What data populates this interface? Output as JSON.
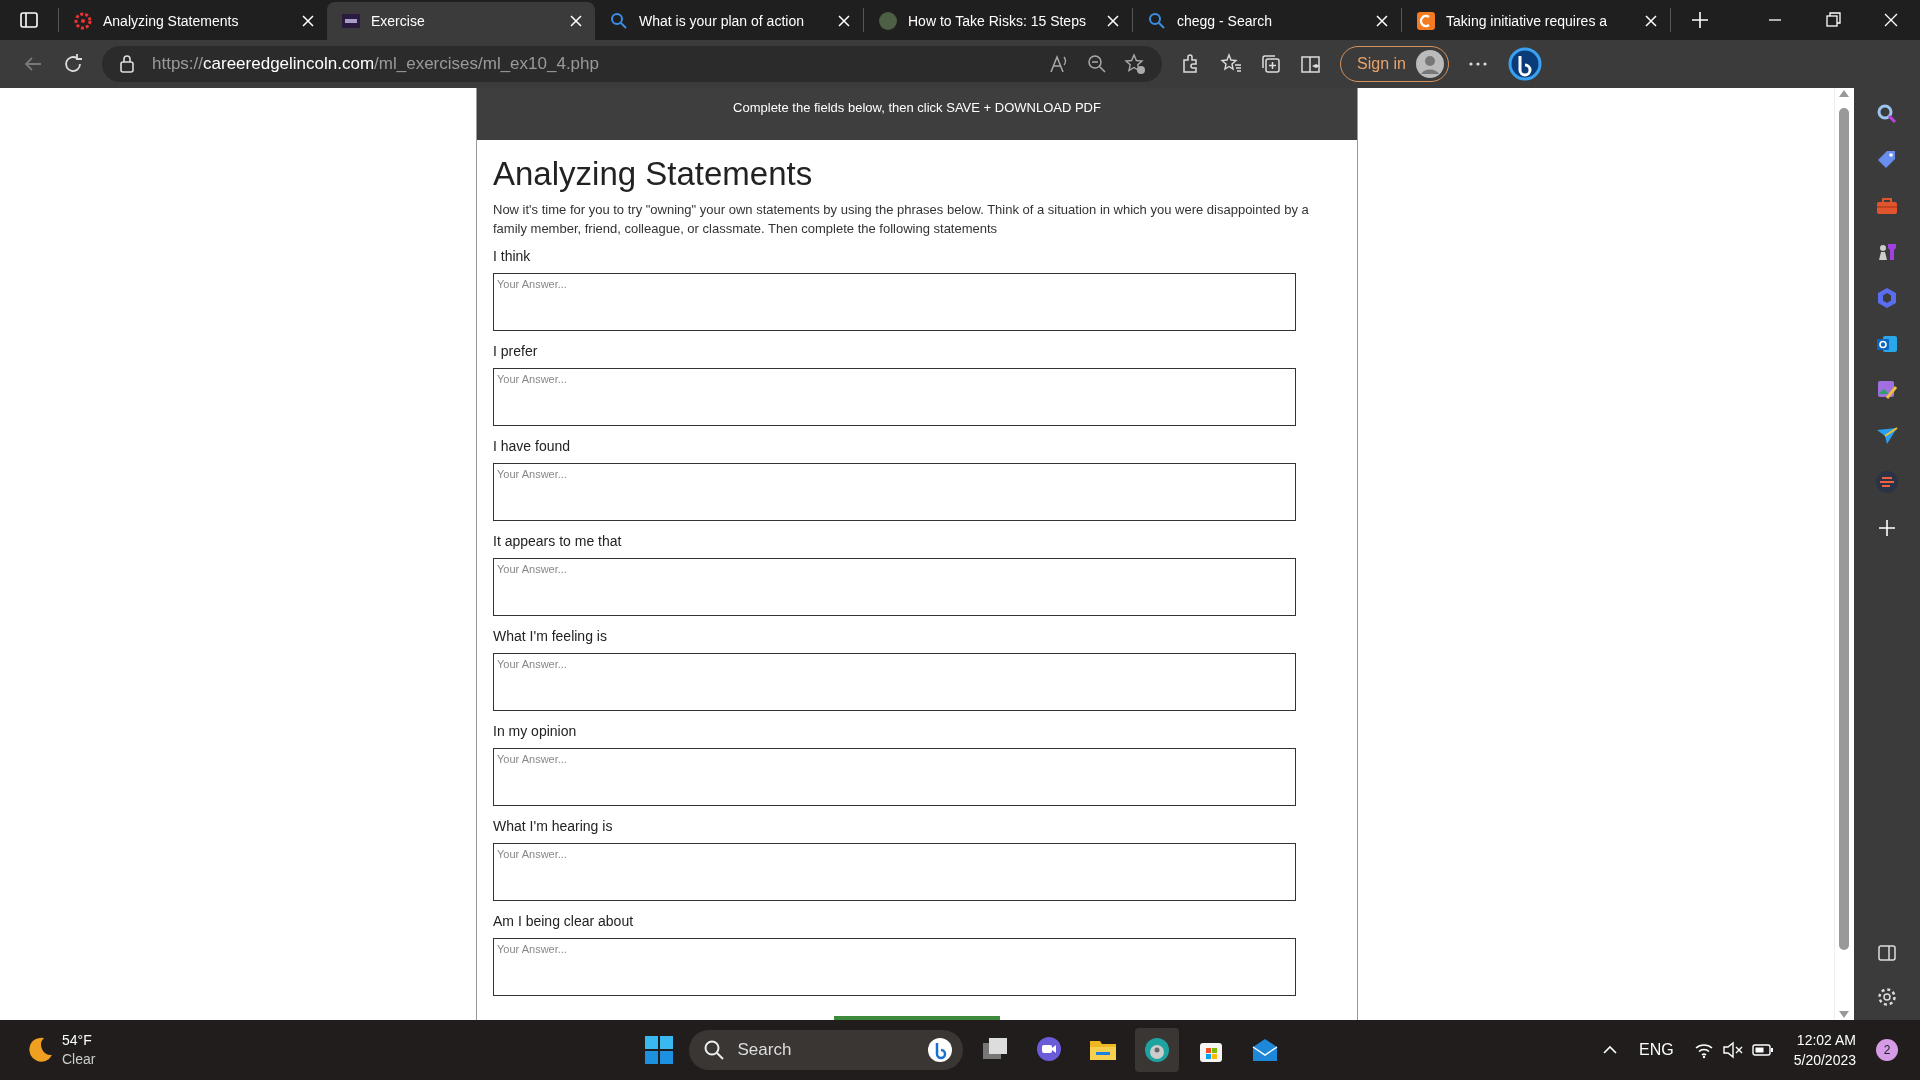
{
  "browser": {
    "tabs": [
      {
        "kind": "ring",
        "title": "Analyzing Statements",
        "selected": false
      },
      {
        "kind": "square",
        "title": "Exercise",
        "selected": true
      },
      {
        "kind": "search",
        "title": "What is your plan of action",
        "selected": false
      },
      {
        "kind": "circle",
        "title": "How to Take Risks: 15 Steps",
        "selected": false
      },
      {
        "kind": "search",
        "title": "chegg - Search",
        "selected": false
      },
      {
        "kind": "letter",
        "title": "Taking initiative requires a",
        "selected": false
      }
    ],
    "address": {
      "scheme": "https://",
      "host": "careeredgelincoln.com",
      "path": "/ml_exercises/ml_ex10_4.php"
    },
    "sign_in": "Sign in"
  },
  "page": {
    "banner": "Complete the fields below, then click SAVE + DOWNLOAD PDF",
    "title": "Analyzing Statements",
    "intro": "Now it's time for you to try \"owning\" your own statements by using the phrases below. Think of a situation in which you were disappointed by a family member, friend, colleague, or classmate. Then complete the following statements",
    "questions": [
      {
        "label": "I think",
        "placeholder": "Your Answer..."
      },
      {
        "label": "I prefer",
        "placeholder": "Your Answer..."
      },
      {
        "label": "I have found",
        "placeholder": "Your Answer..."
      },
      {
        "label": "It appears to me that",
        "placeholder": "Your Answer..."
      },
      {
        "label": "What I'm feeling is",
        "placeholder": "Your Answer..."
      },
      {
        "label": "In my opinion",
        "placeholder": "Your Answer..."
      },
      {
        "label": "What I'm hearing is",
        "placeholder": "Your Answer..."
      },
      {
        "label": "Am I being clear about",
        "placeholder": "Your Answer..."
      }
    ]
  },
  "taskbar": {
    "temperature": "54°F",
    "condition": "Clear",
    "search_placeholder": "Search",
    "language": "ENG",
    "time": "12:02 AM",
    "date": "5/20/2023",
    "notifications": "2"
  }
}
